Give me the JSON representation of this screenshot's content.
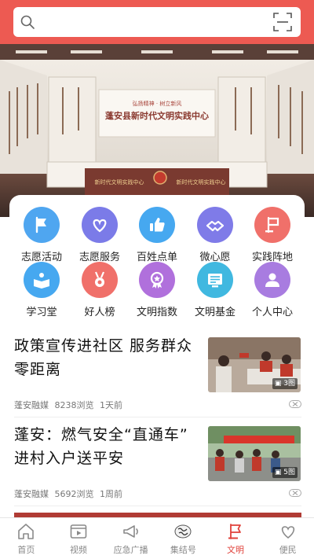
{
  "search": {
    "placeholder": ""
  },
  "banner": {
    "title": "蓬安县新时代文明实践中心",
    "slogan": "弘扬精神 · 树立新风",
    "desk_left": "新时代文明实践中心",
    "desk_right": "新时代文明实践中心",
    "wall_left": [
      "成风化俗",
      "观此向善",
      "新时代新人"
    ],
    "wall_right": [
      "奋斗精神",
      "兴文化"
    ]
  },
  "services": [
    {
      "label": "志愿活动",
      "icon": "flag-icon",
      "color": "#4fa6f0"
    },
    {
      "label": "志愿服务",
      "icon": "heart-hands-icon",
      "color": "#7b7be8"
    },
    {
      "label": "百姓点单",
      "icon": "thumbs-up-icon",
      "color": "#46a8f0"
    },
    {
      "label": "微心愿",
      "icon": "handshake-icon",
      "color": "#7f7be8"
    },
    {
      "label": "实践阵地",
      "icon": "flag-post-icon",
      "color": "#f0706a"
    },
    {
      "label": "学习堂",
      "icon": "book-reader-icon",
      "color": "#46a8f0"
    },
    {
      "label": "好人榜",
      "icon": "medal-icon",
      "color": "#f0706a"
    },
    {
      "label": "文明指数",
      "icon": "award-icon",
      "color": "#b070dc"
    },
    {
      "label": "文明基金",
      "icon": "certificate-icon",
      "color": "#40b8e0"
    },
    {
      "label": "个人中心",
      "icon": "user-icon",
      "color": "#a87ce0"
    }
  ],
  "news": [
    {
      "title": "政策宣传进社区 服务群众零距离",
      "source": "蓬安融媒",
      "views": "8238浏览",
      "time": "1天前",
      "image_count": "3图"
    },
    {
      "title": "蓬安：燃气安全“直通车” 进村入户送平安",
      "source": "蓬安融媒",
      "views": "5692浏览",
      "time": "1周前",
      "image_count": "5图"
    }
  ],
  "nav": [
    {
      "label": "首页",
      "icon": "home-icon",
      "active": false
    },
    {
      "label": "视频",
      "icon": "video-icon",
      "active": false
    },
    {
      "label": "应急广播",
      "icon": "megaphone-icon",
      "active": false
    },
    {
      "label": "集结号",
      "icon": "gathering-icon",
      "active": false
    },
    {
      "label": "文明",
      "icon": "civilization-icon",
      "active": true
    },
    {
      "label": "便民",
      "icon": "heart-icon",
      "active": false
    }
  ],
  "colors": {
    "brand": "#ed5a52",
    "active_nav": "#e0413a"
  }
}
